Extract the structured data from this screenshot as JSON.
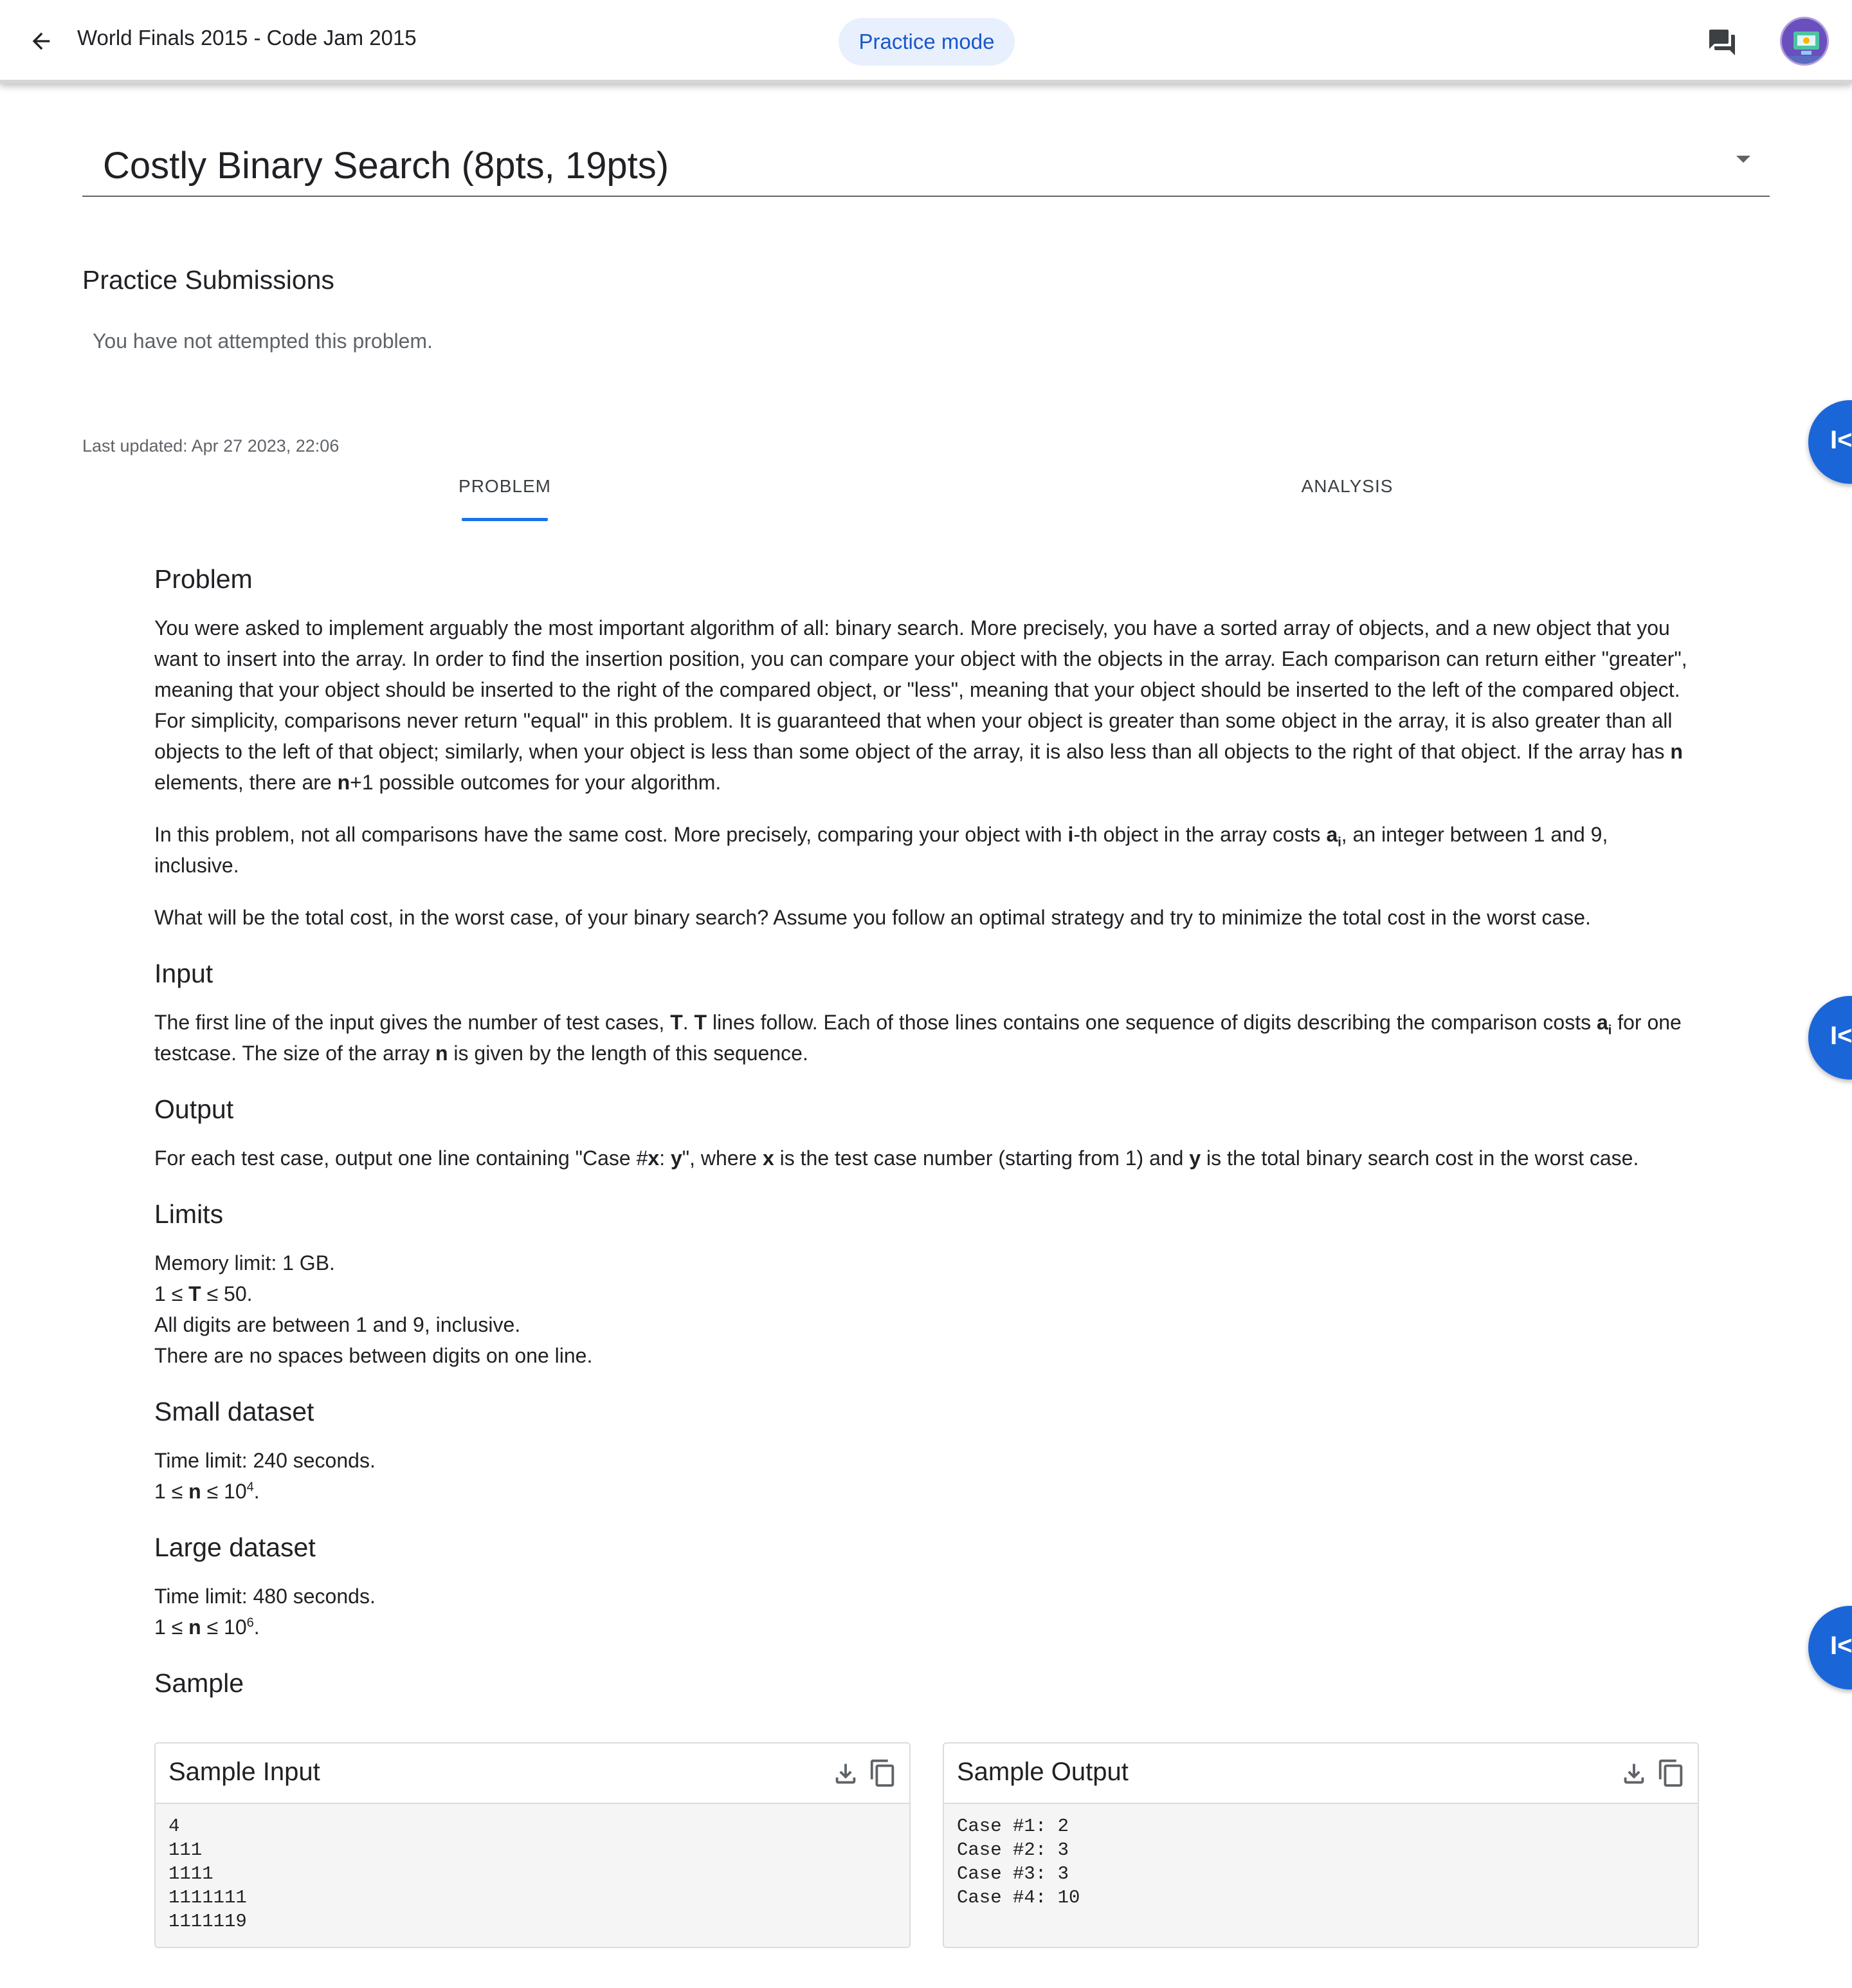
{
  "header": {
    "breadcrumb": "World Finals 2015 - Code Jam 2015",
    "practice_mode": "Practice mode",
    "accent": "#1a73e8"
  },
  "problem_selector": {
    "title": "Costly Binary Search (8pts, 19pts)"
  },
  "submissions": {
    "heading": "Practice Submissions",
    "empty_text": "You have not attempted this problem."
  },
  "last_updated": "Last updated: Apr 27 2023, 22:06",
  "tabs": [
    {
      "label": "PROBLEM",
      "active": true
    },
    {
      "label": "ANALYSIS",
      "active": false
    }
  ],
  "statement": {
    "problem_heading": "Problem",
    "p1_a": "You were asked to implement arguably the most important algorithm of all: binary search. More precisely, you have a sorted array of objects, and a new object that you want to insert into the array. In order to find the insertion position, you can compare your object with the objects in the array. Each comparison can return either \"greater\", meaning that your object should be inserted to the right of the compared object, or \"less\", meaning that your object should be inserted to the left of the compared object. For simplicity, comparisons never return \"equal\" in this problem. It is guaranteed that when your object is greater than some object in the array, it is also greater than all objects to the left of that object; similarly, when your object is less than some object of the array, it is also less than all objects to the right of that object. If the array has ",
    "p1_n": "n",
    "p1_b": " elements, there are ",
    "p1_n2": "n",
    "p1_c": "+1 possible outcomes for your algorithm.",
    "p2_a": "In this problem, not all comparisons have the same cost. More precisely, comparing your object with ",
    "p2_i": "i",
    "p2_b": "-th object in the array costs ",
    "p2_ai": "a",
    "p2_sub": "i",
    "p2_c": ", an integer between 1 and 9, inclusive.",
    "p3": "What will be the total cost, in the worst case, of your binary search? Assume you follow an optimal strategy and try to minimize the total cost in the worst case.",
    "input_heading": "Input",
    "in_a": "The first line of the input gives the number of test cases, ",
    "in_T": "T",
    "in_b": ". ",
    "in_T2": "T",
    "in_c": " lines follow. Each of those lines contains one sequence of digits describing the comparison costs ",
    "in_ai": "a",
    "in_sub": "i",
    "in_d": " for one testcase. The size of the array ",
    "in_n": "n",
    "in_e": " is given by the length of this sequence.",
    "output_heading": "Output",
    "out_a": "For each test case, output one line containing \"Case #",
    "out_x": "x",
    "out_b": ": ",
    "out_y": "y",
    "out_c": "\", where ",
    "out_x2": "x",
    "out_d": " is the test case number (starting from 1) and ",
    "out_y2": "y",
    "out_e": " is the total binary search cost in the worst case.",
    "limits_heading": "Limits",
    "lim1": "Memory limit: 1 GB.",
    "lim2_a": "1 ≤ ",
    "lim2_T": "T",
    "lim2_b": " ≤ 50.",
    "lim3": "All digits are between 1 and 9, inclusive.",
    "lim4": "There are no spaces between digits on one line.",
    "small_heading": "Small dataset",
    "small_time": "Time limit: 240 seconds.",
    "small_a": "1 ≤ ",
    "small_n": "n",
    "small_b": " ≤ 10",
    "small_exp": "4",
    "small_c": ".",
    "large_heading": "Large dataset",
    "large_time": "Time limit: 480 seconds.",
    "large_a": "1 ≤ ",
    "large_n": "n",
    "large_b": " ≤ 10",
    "large_exp": "6",
    "large_c": ".",
    "sample_heading": "Sample"
  },
  "sample_input": {
    "label": "Sample Input",
    "content": "4\n111\n1111\n1111111\n1111119"
  },
  "sample_output": {
    "label": "Sample Output",
    "content": "Case #1: 2\nCase #2: 3\nCase #3: 3\nCase #4: 10"
  },
  "side_fab_glyph": "I<"
}
